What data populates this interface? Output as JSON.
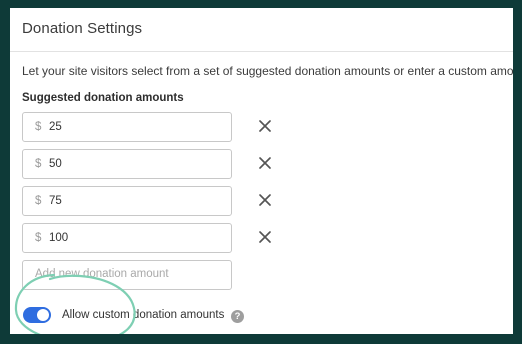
{
  "panel": {
    "title": "Donation Settings",
    "description": "Let your site visitors select from a set of suggested donation amounts or enter a custom amount"
  },
  "suggested": {
    "label": "Suggested donation amounts",
    "currency_symbol": "$",
    "amounts": [
      "25",
      "50",
      "75",
      "100"
    ],
    "remove_icon": "close-icon",
    "new_amount_placeholder": "Add new donation amount"
  },
  "custom": {
    "toggle_on": true,
    "label": "Allow custom donation amounts",
    "help_glyph": "?",
    "help_icon": "question-circle-icon"
  },
  "colors": {
    "outer_background": "#0e3a38",
    "toggle_on": "#2f6de0",
    "highlight_ring": "#7ecfb3"
  }
}
